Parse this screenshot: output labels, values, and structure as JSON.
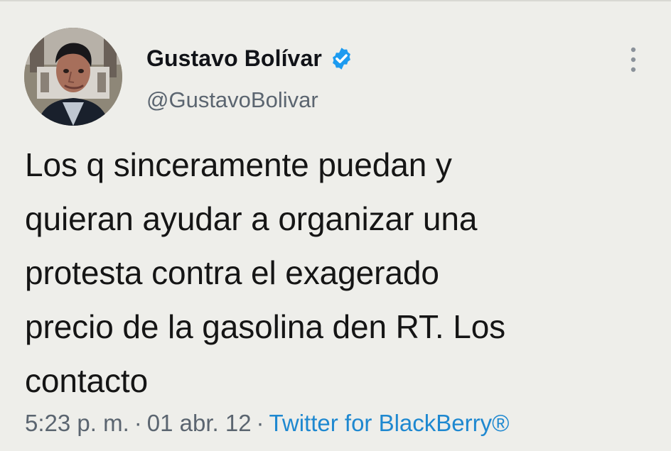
{
  "tweet": {
    "display_name": "Gustavo Bolívar",
    "handle": "@GustavoBolivar",
    "verified_icon": "verified-badge-icon",
    "text": "Los q sinceramente puedan y\nquieran ayudar a organizar una\nprotesta contra el exagerado\nprecio de la gasolina den RT. Los\ncontacto",
    "time": "5:23 p. m.",
    "separator": "·",
    "date": "01 abr. 12",
    "source": "Twitter for BlackBerry®"
  },
  "colors": {
    "background": "#eeeeea",
    "name": "#111318",
    "secondary_text": "#5b6570",
    "link": "#1e88d0",
    "verified": "#1d9bf0"
  },
  "icons": {
    "avatar": "profile-photo",
    "menu": "vertical-ellipsis-icon"
  }
}
